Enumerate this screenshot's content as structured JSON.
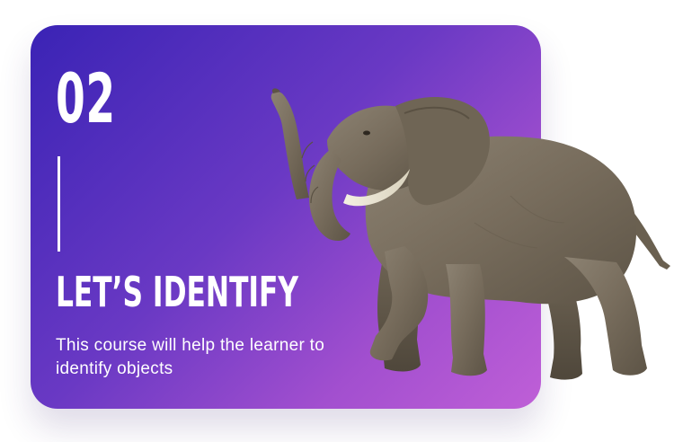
{
  "card": {
    "number": "02",
    "title": "LET’S IDENTIFY",
    "description": "This course will help the learner to identify objects"
  },
  "colors": {
    "gradient_start": "#3a23b5",
    "gradient_end": "#bf5fd7",
    "text": "#ffffff",
    "elephant_skin": "#7d7161",
    "tusk": "#ece7d6"
  },
  "illustration": {
    "subject": "elephant"
  }
}
